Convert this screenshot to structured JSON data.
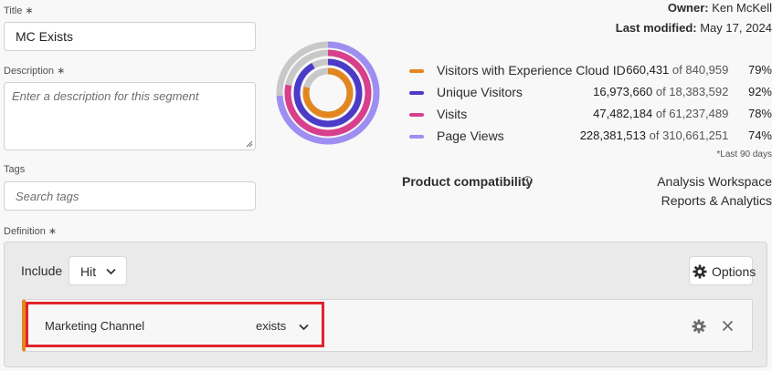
{
  "form": {
    "title_label": "Title ∗",
    "title_value": "MC Exists",
    "description_label": "Description ∗",
    "description_placeholder": "Enter a description for this segment",
    "tags_label": "Tags",
    "tags_placeholder": "Search tags",
    "definition_label": "Definition ∗"
  },
  "meta": {
    "owner_label": "Owner:",
    "owner_value": "Ken McKell",
    "modified_label": "Last modified:",
    "modified_value": "May 17, 2024"
  },
  "summary": {
    "rows": [
      {
        "name": "Visitors with Experience Cloud ID",
        "value": "660,431",
        "total": "of 840,959",
        "pct": "79%",
        "color": "#e2871f",
        "fraction": 0.79
      },
      {
        "name": "Unique Visitors",
        "value": "16,973,660",
        "total": "of 18,383,592",
        "pct": "92%",
        "color": "#4b3bc7",
        "fraction": 0.92
      },
      {
        "name": "Visits",
        "value": "47,482,184",
        "total": "of 61,237,489",
        "pct": "78%",
        "color": "#d83f8c",
        "fraction": 0.78
      },
      {
        "name": "Page Views",
        "value": "228,381,513",
        "total": "of 310,661,251",
        "pct": "74%",
        "color": "#9f8ef2",
        "fraction": 0.74
      }
    ],
    "footnote": "*Last 90 days",
    "ring_track_color": "#c8c8c8"
  },
  "compatibility": {
    "label": "Product compatibility",
    "info_icon": "info-icon",
    "products": [
      "Analysis Workspace",
      "Reports & Analytics"
    ]
  },
  "definition": {
    "include_label": "Include",
    "scope_value": "Hit",
    "options_label": "Options",
    "rule": {
      "dimension": "Marketing Channel",
      "operator": "exists"
    },
    "accent_color": "#e3881d",
    "highlight_color": "#e0242e"
  }
}
